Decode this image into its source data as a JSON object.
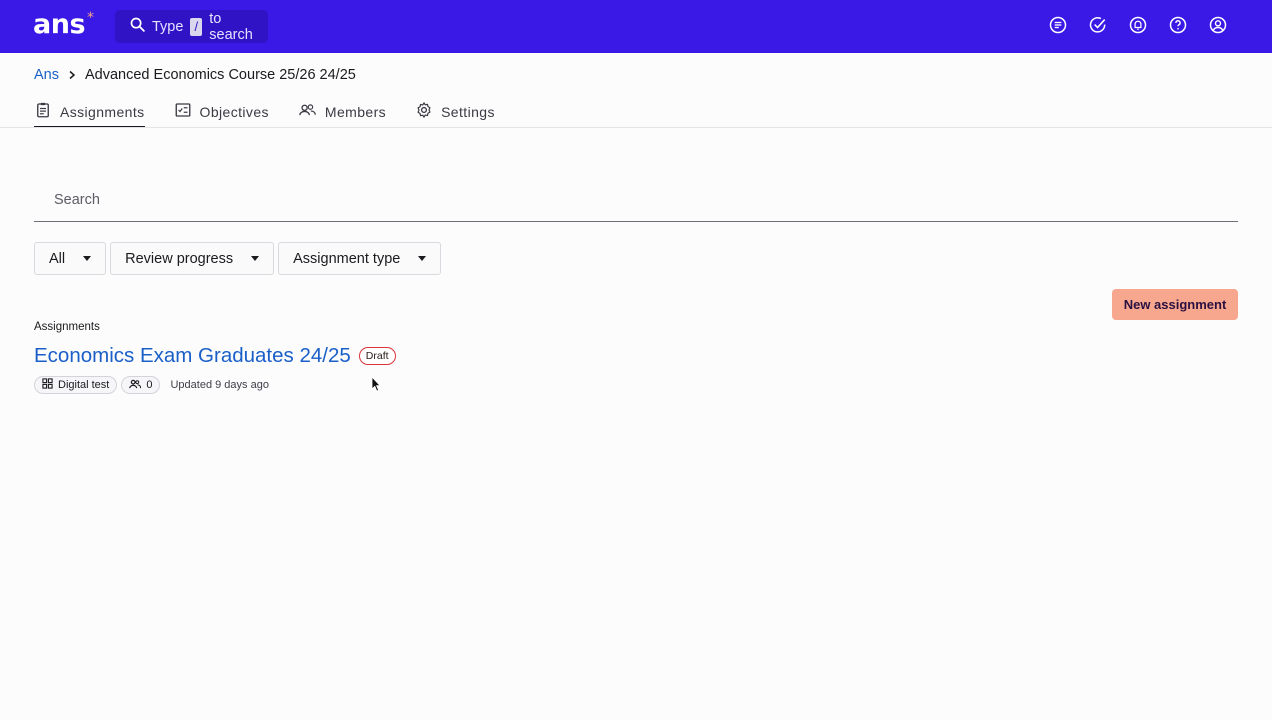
{
  "topbar": {
    "logo": "ans",
    "logo_star": "*",
    "search_prefix": "Type",
    "search_key": "/",
    "search_suffix": "to search",
    "icons": [
      "messages-icon",
      "tasks-check-icon",
      "notifications-icon",
      "help-icon",
      "account-icon"
    ]
  },
  "breadcrumb": {
    "root": "Ans",
    "current": "Advanced Economics Course 25/26 24/25"
  },
  "tabs": [
    {
      "label": "Assignments",
      "icon": "clipboard-icon",
      "active": true
    },
    {
      "label": "Objectives",
      "icon": "checklist-icon",
      "active": false
    },
    {
      "label": "Members",
      "icon": "people-icon",
      "active": false
    },
    {
      "label": "Settings",
      "icon": "gear-icon",
      "active": false
    }
  ],
  "search": {
    "placeholder": "Search",
    "value": ""
  },
  "filters": [
    {
      "label": "All"
    },
    {
      "label": "Review progress"
    },
    {
      "label": "Assignment type"
    }
  ],
  "new_assignment_label": "New assignment",
  "section_label": "Assignments",
  "assignment": {
    "title": "Economics Exam Graduates 24/25",
    "status": "Draft",
    "type": "Digital test",
    "participants": "0",
    "updated": "Updated 9 days ago"
  },
  "colors": {
    "topbar": "#3a19e6",
    "accent_link": "#1a5fc8",
    "new_button": "#f8a78f",
    "draft_border": "#d9343a"
  }
}
